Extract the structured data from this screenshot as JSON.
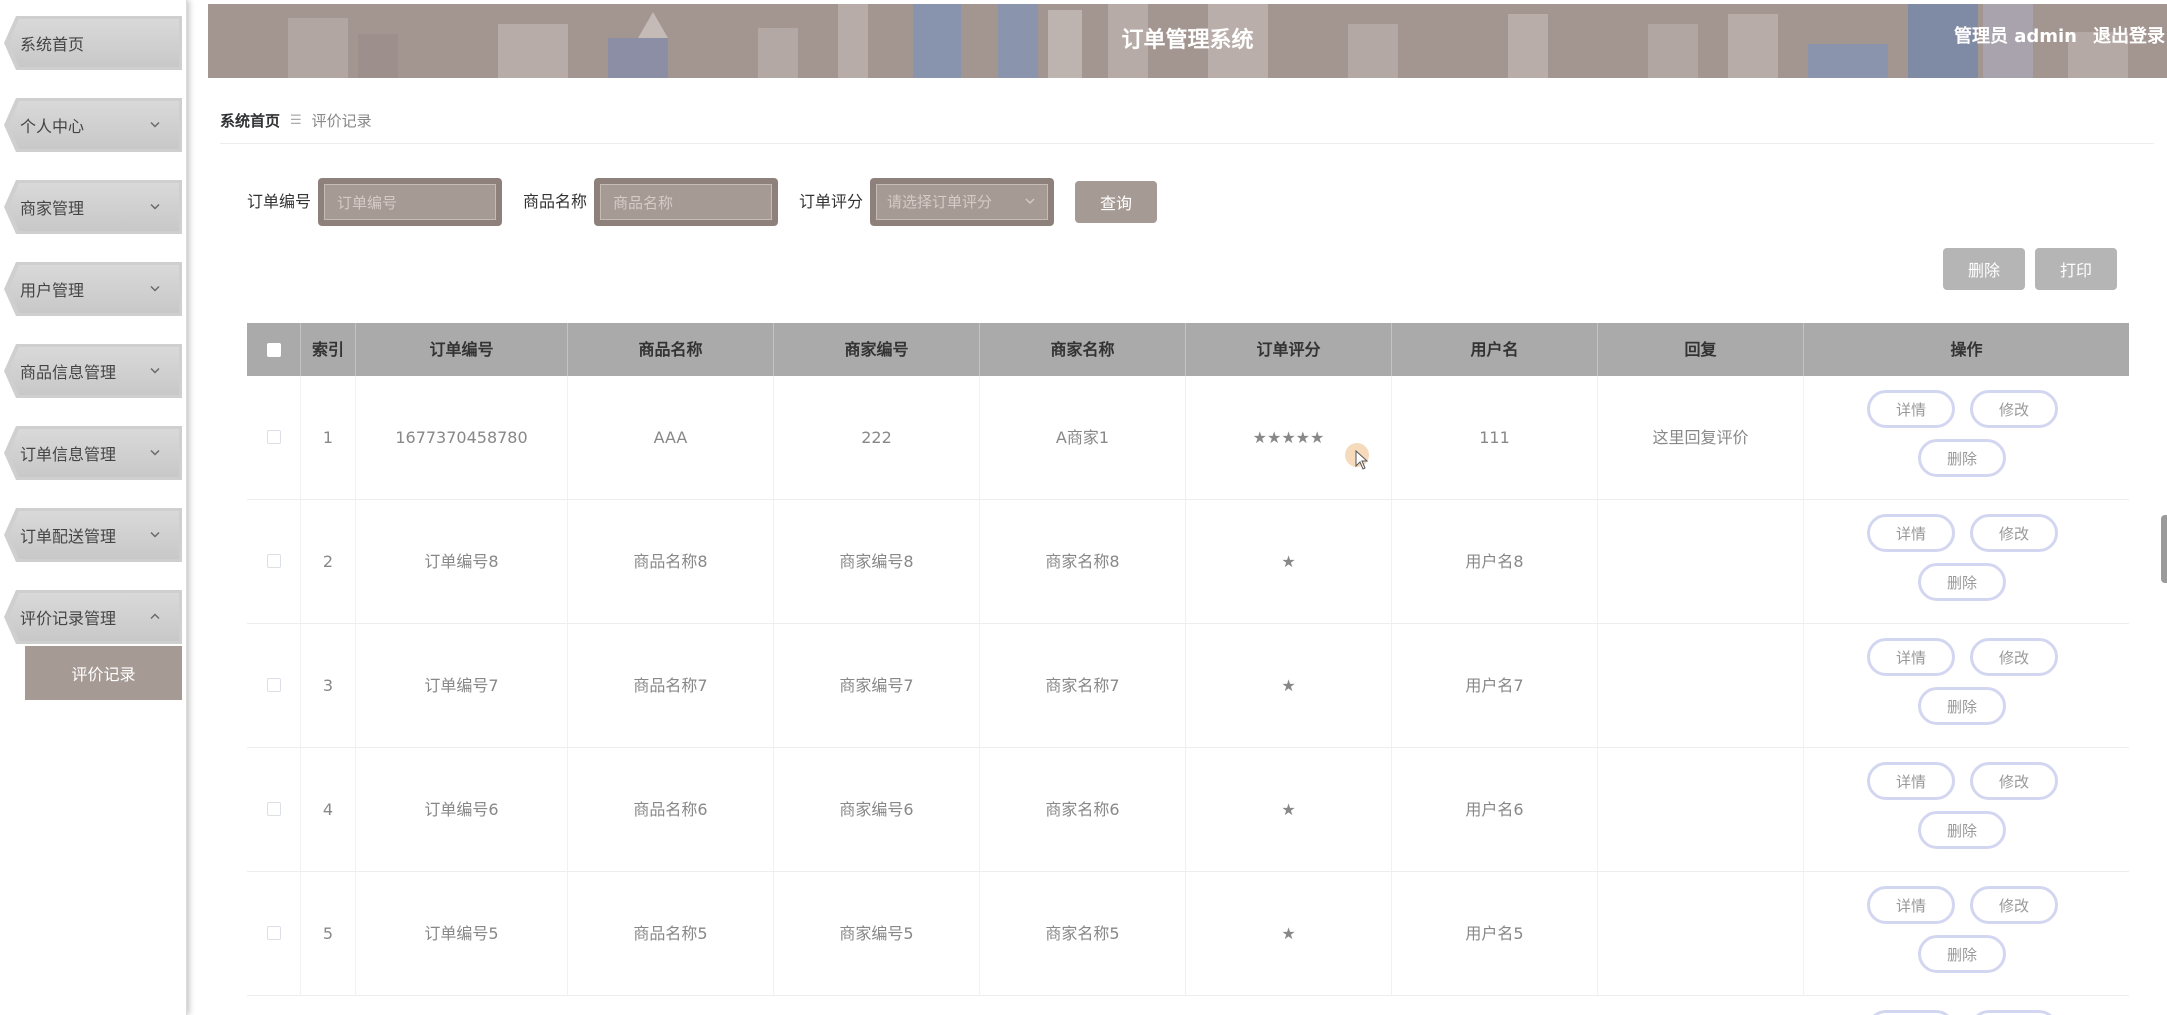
{
  "app": {
    "title": "订单管理系统",
    "user_label": "管理员 admin",
    "logout_label": "退出登录"
  },
  "sidebar": {
    "items": [
      {
        "label": "系统首页",
        "chevron": "none"
      },
      {
        "label": "个人中心",
        "chevron": "down"
      },
      {
        "label": "商家管理",
        "chevron": "down"
      },
      {
        "label": "用户管理",
        "chevron": "down"
      },
      {
        "label": "商品信息管理",
        "chevron": "down"
      },
      {
        "label": "订单信息管理",
        "chevron": "down"
      },
      {
        "label": "订单配送管理",
        "chevron": "down"
      },
      {
        "label": "评价记录管理",
        "chevron": "up"
      }
    ],
    "submenu": {
      "label": "评价记录"
    }
  },
  "breadcrumb": {
    "home": "系统首页",
    "separator": "☰",
    "current": "评价记录"
  },
  "search": {
    "order_no_label": "订单编号",
    "order_no_placeholder": "订单编号",
    "product_label": "商品名称",
    "product_placeholder": "商品名称",
    "rating_label": "订单评分",
    "rating_placeholder": "请选择订单评分",
    "query_button": "查询"
  },
  "actions": {
    "delete_button": "删除",
    "print_button": "打印"
  },
  "table": {
    "columns": [
      "索引",
      "订单编号",
      "商品名称",
      "商家编号",
      "商家名称",
      "订单评分",
      "用户名",
      "回复",
      "操作"
    ],
    "rows": [
      {
        "index": "1",
        "order_no": "1677370458780",
        "product": "AAA",
        "merchant_no": "222",
        "merchant_name": "A商家1",
        "rating": "★★★★★",
        "username": "111",
        "reply": "这里回复评价"
      },
      {
        "index": "2",
        "order_no": "订单编号8",
        "product": "商品名称8",
        "merchant_no": "商家编号8",
        "merchant_name": "商家名称8",
        "rating": "★",
        "username": "用户名8",
        "reply": ""
      },
      {
        "index": "3",
        "order_no": "订单编号7",
        "product": "商品名称7",
        "merchant_no": "商家编号7",
        "merchant_name": "商家名称7",
        "rating": "★",
        "username": "用户名7",
        "reply": ""
      },
      {
        "index": "4",
        "order_no": "订单编号6",
        "product": "商品名称6",
        "merchant_no": "商家编号6",
        "merchant_name": "商家名称6",
        "rating": "★",
        "username": "用户名6",
        "reply": ""
      },
      {
        "index": "5",
        "order_no": "订单编号5",
        "product": "商品名称5",
        "merchant_no": "商家编号5",
        "merchant_name": "商家名称5",
        "rating": "★",
        "username": "用户名5",
        "reply": ""
      }
    ],
    "row_actions": {
      "detail": "详情",
      "edit": "修改",
      "delete": "删除"
    }
  },
  "colors": {
    "accent": "#a59a94",
    "header_bg": "#9a8a86",
    "table_header_bg": "#aaaaaa",
    "pill_border": "#d3d6f0"
  }
}
